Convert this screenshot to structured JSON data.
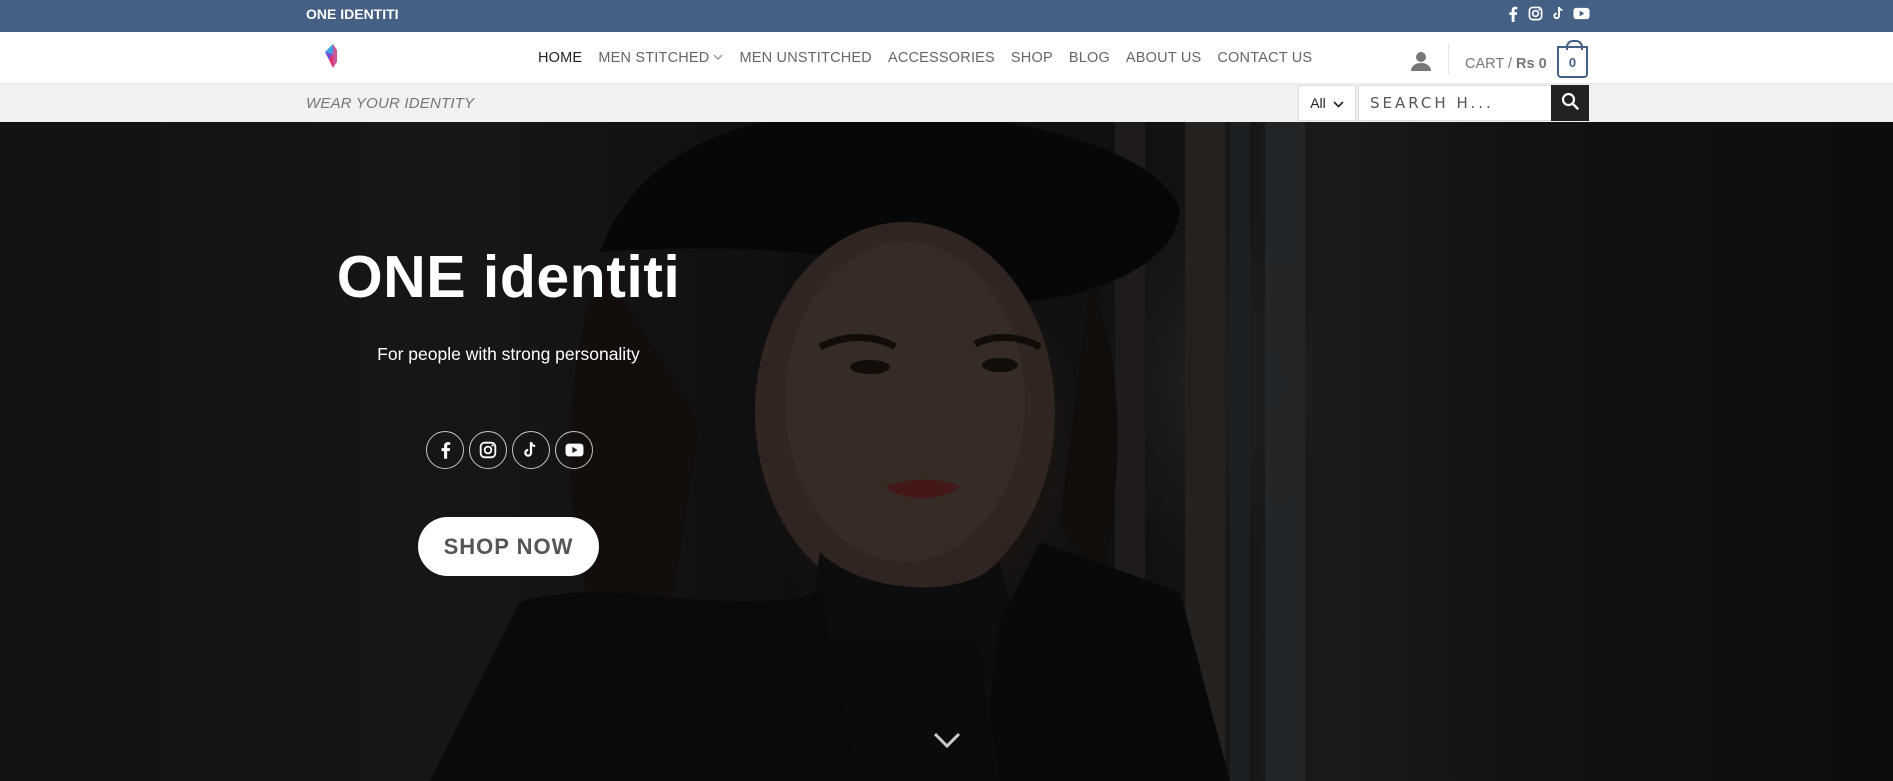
{
  "topbar": {
    "brand": "ONE IDENTITI",
    "social_icons": [
      "facebook-icon",
      "instagram-icon",
      "tiktok-icon",
      "youtube-icon"
    ],
    "background": "#446084"
  },
  "header": {
    "nav": [
      {
        "label": "HOME",
        "active": true
      },
      {
        "label": "MEN STITCHED",
        "has_dropdown": true
      },
      {
        "label": "MEN UNSTITCHED"
      },
      {
        "label": "ACCESSORIES"
      },
      {
        "label": "SHOP"
      },
      {
        "label": "BLOG"
      },
      {
        "label": "ABOUT US"
      },
      {
        "label": "CONTACT US"
      }
    ],
    "cart_label": "CART /",
    "cart_amount": "Rs 0",
    "cart_count": "0",
    "accent": "#446084"
  },
  "subbar": {
    "tagline": "WEAR YOUR IDENTITY",
    "category": "All",
    "search_placeholder": "SEARCH H..."
  },
  "hero": {
    "title": "ONE identiti",
    "subtitle": "For people with strong personality",
    "cta": "SHOP NOW",
    "social_icons": [
      "facebook-icon",
      "instagram-icon",
      "tiktok-icon",
      "youtube-icon"
    ]
  }
}
